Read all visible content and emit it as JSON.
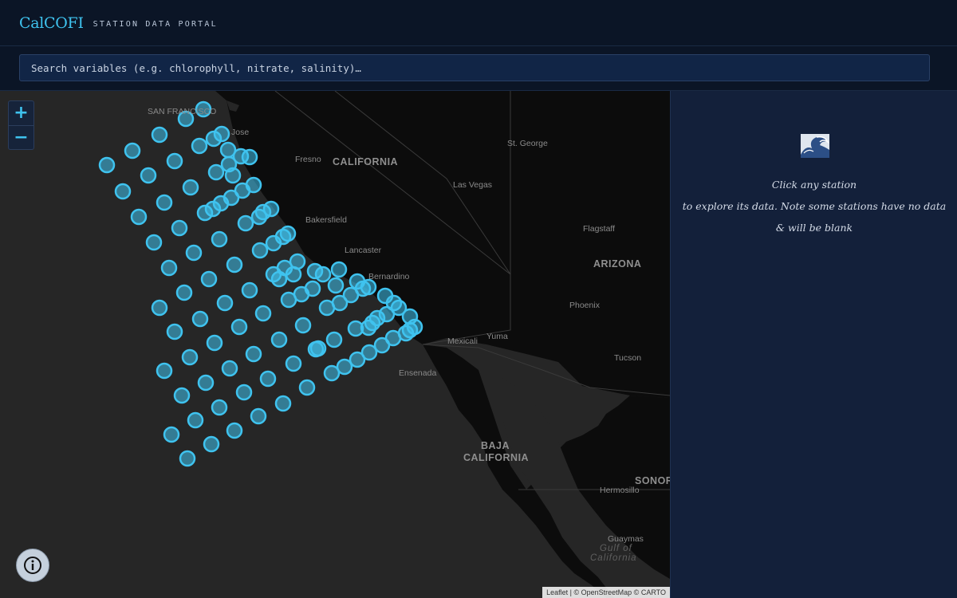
{
  "header": {
    "brand": "CalCOFI",
    "tagline": "STATION DATA PORTAL"
  },
  "search": {
    "placeholder": "Search variables (e.g. chlorophyll, nitrate, salinity)…",
    "value": ""
  },
  "map": {
    "zoom_in_label": "+",
    "zoom_out_label": "−",
    "marker_color": "#3fc3ef",
    "places": [
      {
        "name": "SAN FRANCISCO",
        "kind": "city"
      },
      {
        "name": "Jose",
        "kind": "city"
      },
      {
        "name": "Fresno",
        "kind": "city"
      },
      {
        "name": "CALIFORNIA",
        "kind": "state"
      },
      {
        "name": "St. George",
        "kind": "city"
      },
      {
        "name": "Las Vegas",
        "kind": "city"
      },
      {
        "name": "Bakersfield",
        "kind": "city"
      },
      {
        "name": "Flagstaff",
        "kind": "city"
      },
      {
        "name": "Lancaster",
        "kind": "city"
      },
      {
        "name": "ARIZONA",
        "kind": "state"
      },
      {
        "name": "Bernardino",
        "kind": "city"
      },
      {
        "name": "Phoenix",
        "kind": "city"
      },
      {
        "name": "Yuma",
        "kind": "city"
      },
      {
        "name": "Mexicali",
        "kind": "city"
      },
      {
        "name": "Tucson",
        "kind": "city"
      },
      {
        "name": "Ensenada",
        "kind": "city"
      },
      {
        "name": "BAJA",
        "kind": "state"
      },
      {
        "name": "CALIFORNIA",
        "kind": "state"
      },
      {
        "name": "SONOR",
        "kind": "state"
      },
      {
        "name": "Hermosillo",
        "kind": "city"
      },
      {
        "name": "Guaymas",
        "kind": "city"
      },
      {
        "name": "Gulf of",
        "kind": "water"
      },
      {
        "name": "California",
        "kind": "water"
      }
    ],
    "attribution": "Leaflet | © OpenStreetMap © CARTO"
  },
  "info_button": {
    "icon": "info-icon"
  },
  "panel": {
    "icon": "wave-icon",
    "line1": "Click any station",
    "line2": "to explore its data. Note some stations have no data",
    "line3": "& will be blank"
  }
}
